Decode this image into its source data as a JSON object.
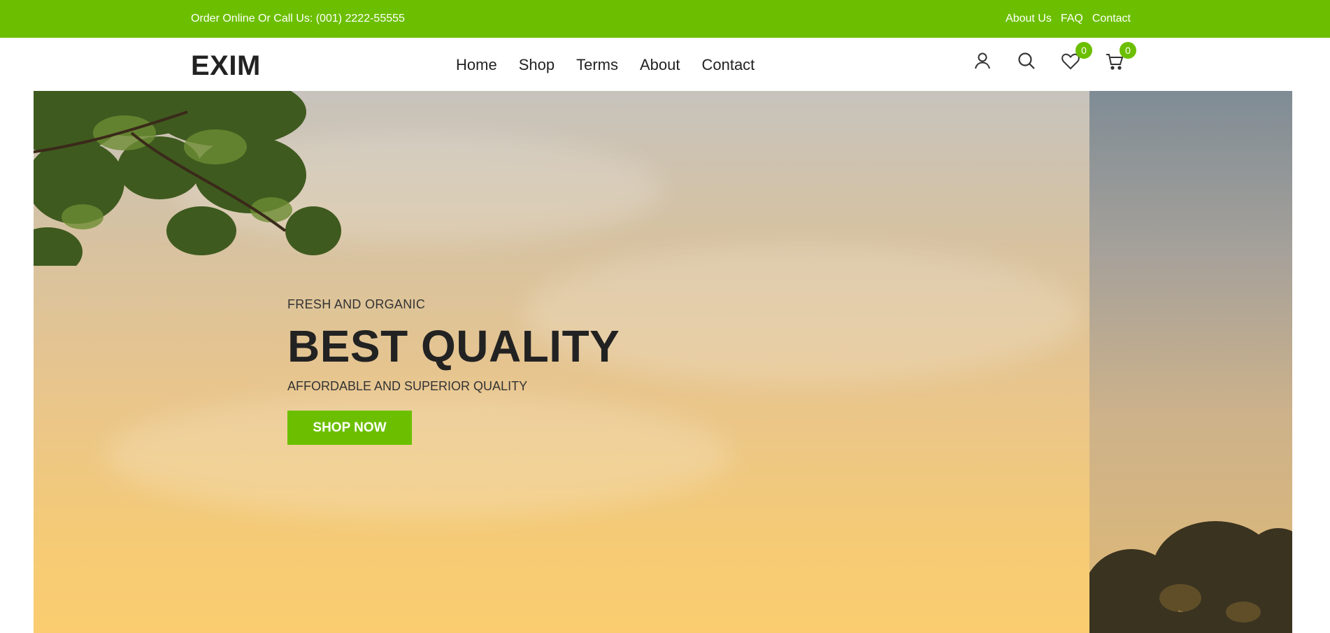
{
  "topbar": {
    "phone_text": "Order Online Or Call Us: (001) 2222-55555",
    "links": [
      "About Us",
      "FAQ",
      "Contact"
    ]
  },
  "header": {
    "logo": "EXIM",
    "nav": [
      "Home",
      "Shop",
      "Terms",
      "About",
      "Contact"
    ],
    "icons": [
      "user-icon",
      "search-icon",
      "heart-icon",
      "cart-icon"
    ],
    "wishlist_count": "0",
    "cart_count": "0"
  },
  "hero": {
    "eyebrow": "FRESH AND ORGANIC",
    "headline": "BEST QUALITY",
    "tagline": "AFFORDABLE AND SUPERIOR QUALITY",
    "button_label": "SHOP NOW"
  },
  "colors": {
    "accent": "#6cbf00",
    "text_dark": "#222222"
  }
}
